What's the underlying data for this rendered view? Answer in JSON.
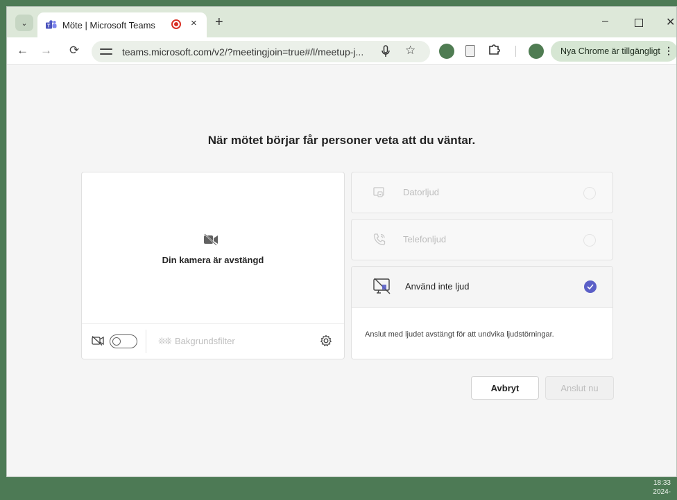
{
  "browser": {
    "tab_title": "Möte | Microsoft Teams",
    "tab_close": "×",
    "new_tab": "+",
    "url": "teams.microsoft.com/v2/?meetingjoin=true#/l/meetup-j...",
    "update_label": "Nya Chrome är tillgängligt",
    "window_controls": {
      "minimize": "–",
      "close": "✕"
    }
  },
  "prejoin": {
    "heading": "När mötet börjar får personer veta att du väntar.",
    "camera_off_text": "Din kamera är avstängd",
    "background_filter_label": "Bakgrundsfilter",
    "audio_options": [
      {
        "label": "Datorljud",
        "icon": "computer-audio-icon",
        "selected": false,
        "enabled": false
      },
      {
        "label": "Telefonljud",
        "icon": "phone-audio-icon",
        "selected": false,
        "enabled": false
      },
      {
        "label": "Använd inte ljud",
        "icon": "no-audio-icon",
        "selected": true,
        "enabled": true
      }
    ],
    "no_audio_description": "Anslut med ljudet avstängt för att undvika ljudstörningar.",
    "cancel_label": "Avbryt",
    "join_label": "Anslut nu"
  },
  "taskbar": {
    "time": "18:33",
    "date": "2024-"
  },
  "colors": {
    "accent": "#5b5fc7",
    "desktop": "#4d7a55",
    "chrome_frame": "#dde8d9"
  }
}
